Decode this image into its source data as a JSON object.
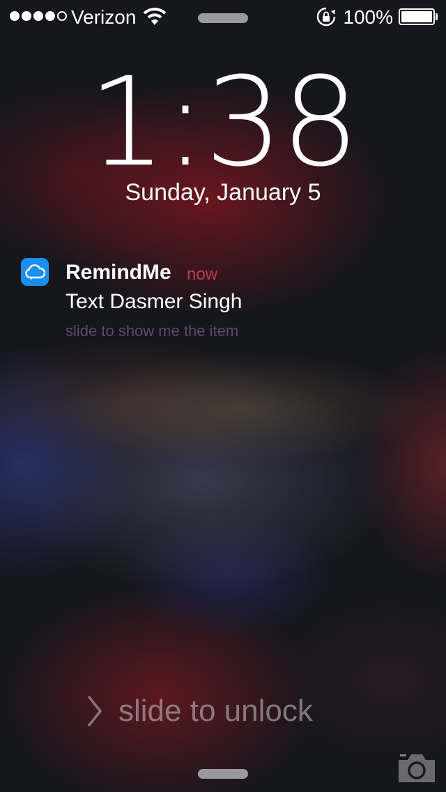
{
  "status_bar": {
    "carrier": "Verizon",
    "signal_bars_filled": 4,
    "signal_bars_total": 5,
    "battery_percent": "100%",
    "battery_level": 1.0
  },
  "lock_screen": {
    "time": "1:38",
    "date": "Sunday, January 5"
  },
  "notification": {
    "app_name": "RemindMe",
    "time": "now",
    "message": "Text Dasmer Singh",
    "action_hint": "slide to show me the item",
    "app_icon": "cloud-icon",
    "app_icon_color": "#1a8ff0",
    "time_color": "#c63a4c"
  },
  "unlock": {
    "label": "slide to unlock",
    "icon": "chevron-right-icon"
  },
  "camera": {
    "icon": "camera-icon"
  }
}
